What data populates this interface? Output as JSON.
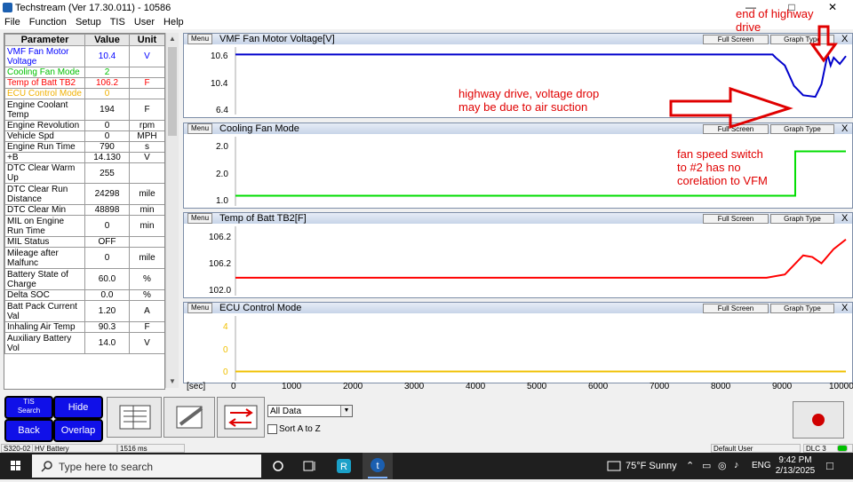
{
  "window": {
    "title": "Techstream (Ver 17.30.011) - 10586"
  },
  "menu": [
    "File",
    "Function",
    "Setup",
    "TIS",
    "User",
    "Help"
  ],
  "table": {
    "headers": [
      "Parameter",
      "Value",
      "Unit"
    ],
    "rows": [
      {
        "name": "VMF Fan Motor Voltage",
        "value": "10.4",
        "unit": "V",
        "color": "#0000ff"
      },
      {
        "name": "Cooling Fan Mode",
        "value": "2",
        "unit": "",
        "color": "#00c000"
      },
      {
        "name": "Temp of Batt TB2",
        "value": "106.2",
        "unit": "F",
        "color": "#ff0000"
      },
      {
        "name": "ECU Control Mode",
        "value": "0",
        "unit": "",
        "color": "#f0b000"
      },
      {
        "name": "Engine Coolant Temp",
        "value": "194",
        "unit": "F",
        "color": "#000000"
      },
      {
        "name": "Engine Revolution",
        "value": "0",
        "unit": "rpm",
        "color": "#000000"
      },
      {
        "name": "Vehicle Spd",
        "value": "0",
        "unit": "MPH",
        "color": "#000000"
      },
      {
        "name": "Engine Run Time",
        "value": "790",
        "unit": "s",
        "color": "#000000"
      },
      {
        "name": "+B",
        "value": "14.130",
        "unit": "V",
        "color": "#000000"
      },
      {
        "name": "DTC Clear Warm Up",
        "value": "255",
        "unit": "",
        "color": "#000000"
      },
      {
        "name": "DTC Clear Run Distance",
        "value": "24298",
        "unit": "mile",
        "color": "#000000"
      },
      {
        "name": "DTC Clear Min",
        "value": "48898",
        "unit": "min",
        "color": "#000000"
      },
      {
        "name": "MIL on Engine Run Time",
        "value": "0",
        "unit": "min",
        "color": "#000000"
      },
      {
        "name": "MIL Status",
        "value": "OFF",
        "unit": "",
        "color": "#000000"
      },
      {
        "name": "Mileage after Malfunc",
        "value": "0",
        "unit": "mile",
        "color": "#000000"
      },
      {
        "name": "Battery State of Charge",
        "value": "60.0",
        "unit": "%",
        "color": "#000000"
      },
      {
        "name": "Delta SOC",
        "value": "0.0",
        "unit": "%",
        "color": "#000000"
      },
      {
        "name": "Batt Pack Current Val",
        "value": "1.20",
        "unit": "A",
        "color": "#000000"
      },
      {
        "name": "Inhaling Air Temp",
        "value": "90.3",
        "unit": "F",
        "color": "#000000"
      },
      {
        "name": "Auxiliary Battery Vol",
        "value": "14.0",
        "unit": "V",
        "color": "#000000"
      }
    ]
  },
  "graph_buttons": {
    "menu": "Menu",
    "full_screen": "Full Screen",
    "graph_type": "Graph Type",
    "close": "X"
  },
  "graphs": [
    {
      "title": "VMF Fan Motor Voltage[V]",
      "color": "#0000cc",
      "ticks": [
        "10.6",
        "10.4",
        "6.4"
      ]
    },
    {
      "title": "Cooling Fan Mode",
      "color": "#00dd00",
      "ticks": [
        "2.0",
        "2.0",
        "1.0"
      ]
    },
    {
      "title": "Temp of Batt TB2[F]",
      "color": "#ff0000",
      "ticks": [
        "106.2",
        "106.2",
        "102.0"
      ]
    },
    {
      "title": "ECU Control Mode",
      "color": "#f0c000",
      "ticks": [
        "4",
        "0",
        "0"
      ]
    }
  ],
  "xaxis": {
    "unit": "[sec]",
    "ticks": [
      "0",
      "1000",
      "2000",
      "3000",
      "4000",
      "5000",
      "6000",
      "7000",
      "8000",
      "9000",
      "10000"
    ]
  },
  "chart_data": [
    {
      "type": "line",
      "title": "VMF Fan Motor Voltage[V]",
      "ylabel": "",
      "xlabel": "[sec]",
      "x": [
        0,
        8800,
        8850,
        9000,
        9150,
        9300,
        9500,
        9600,
        9700,
        9750,
        9800,
        9900,
        10000
      ],
      "values": [
        10.5,
        10.5,
        10.3,
        9.8,
        8.5,
        7.9,
        7.8,
        8.6,
        10.5,
        9.8,
        10.3,
        9.9,
        10.4
      ]
    },
    {
      "type": "line",
      "title": "Cooling Fan Mode",
      "xlabel": "[sec]",
      "x": [
        0,
        9150,
        9170,
        10000
      ],
      "values": [
        1,
        1,
        2,
        2
      ]
    },
    {
      "type": "line",
      "title": "Temp of Batt TB2[F]",
      "xlabel": "[sec]",
      "x": [
        0,
        8700,
        9000,
        9300,
        9450,
        9600,
        9800,
        10000
      ],
      "values": [
        103.2,
        103.2,
        103.4,
        104.6,
        104.5,
        104.1,
        105.0,
        105.6
      ]
    },
    {
      "type": "line",
      "title": "ECU Control Mode",
      "xlabel": "[sec]",
      "x": [
        0,
        10000
      ],
      "values": [
        0,
        0
      ]
    }
  ],
  "annotations": {
    "end_highway": "end of highway drive",
    "highway_drop": [
      "highway drive, voltage drop",
      "may be due to air suction"
    ],
    "fan_switch": [
      "fan speed switch",
      "to #2 has no",
      "corelation to VFM"
    ]
  },
  "buttons": {
    "tis_search": [
      "TIS",
      "Search"
    ],
    "hide": "Hide",
    "back": "Back",
    "overlap": "Overlap"
  },
  "dropdown": {
    "value": "All Data"
  },
  "sort": {
    "label": "Sort A to Z"
  },
  "status": {
    "code": "S320-02",
    "system": "HV Battery",
    "ms": "1516 ms",
    "user": "Default User",
    "dlc": "DLC 3"
  },
  "taskbar": {
    "search_placeholder": "Type here to search",
    "weather": "75°F  Sunny",
    "lang": "ENG",
    "time": "9:42 PM",
    "date": "2/13/2025"
  }
}
